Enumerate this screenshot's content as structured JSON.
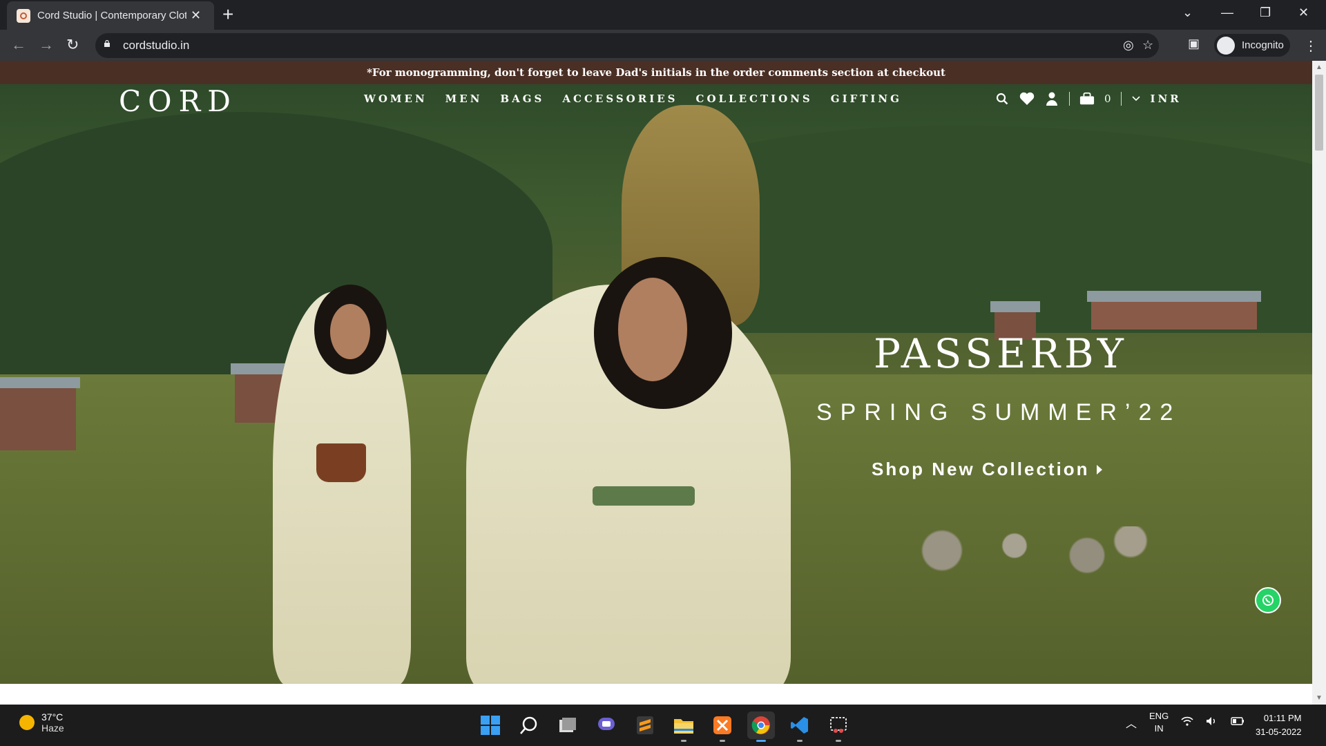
{
  "browser": {
    "tab_title": "Cord Studio | Contemporary Clot",
    "url": "cordstudio.in",
    "profile_label": "Incognito"
  },
  "site": {
    "announcement": "*For monogramming, don't forget to leave Dad's initials in the order comments section at checkout",
    "logo": "CORD",
    "nav": [
      "WOMEN",
      "MEN",
      "BAGS",
      "ACCESSORIES",
      "COLLECTIONS",
      "GIFTING"
    ],
    "cart_count": "0",
    "currency": "INR",
    "hero": {
      "title": "PASSERBY",
      "subtitle": "SPRING SUMMER’22",
      "cta": "Shop New Collection"
    },
    "side_badge": "screenrec"
  },
  "taskbar": {
    "weather_temp": "37°C",
    "weather_desc": "Haze",
    "lang_top": "ENG",
    "lang_bottom": "IN",
    "time": "01:11 PM",
    "date": "31-05-2022"
  },
  "colors": {
    "announcement_bg": "#4a2f25",
    "tab_bg": "#35363a",
    "whatsapp": "#25d366"
  }
}
